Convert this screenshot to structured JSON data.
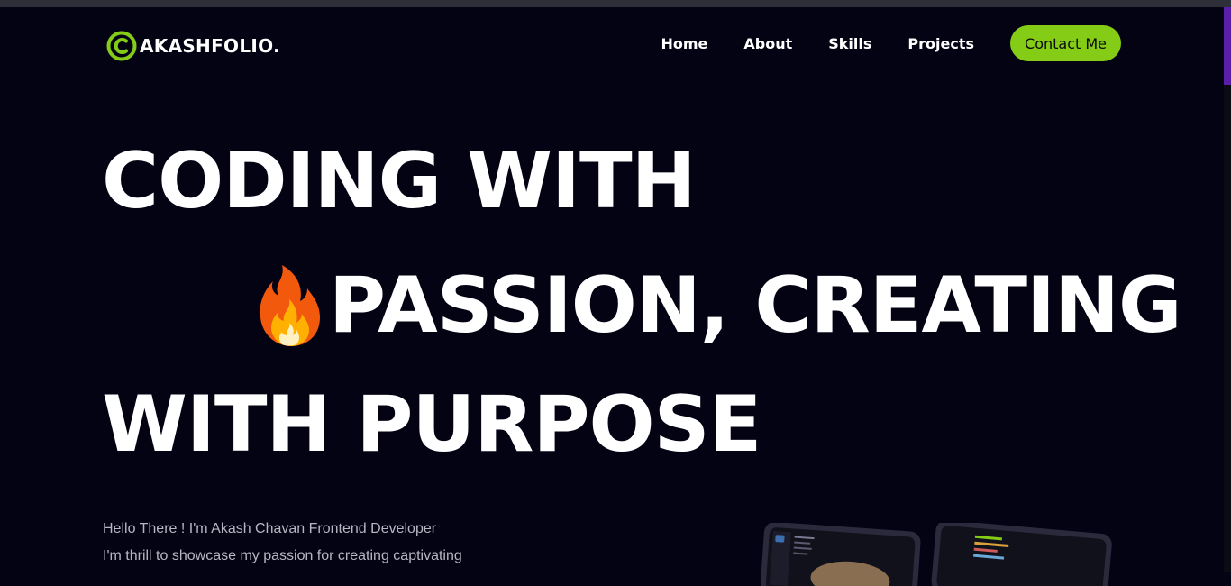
{
  "header": {
    "logo_text": "AKASHFOLIO.",
    "nav": [
      {
        "label": "Home"
      },
      {
        "label": "About"
      },
      {
        "label": "Skills"
      },
      {
        "label": "Projects"
      }
    ],
    "contact_label": "Contact Me"
  },
  "hero": {
    "line1": "CODING WITH",
    "line2": "PASSION, CREATING",
    "line3": "WITH PURPOSE",
    "emoji_icon": "fire-icon"
  },
  "intro": {
    "line1": "Hello There ! I'm Akash Chavan Frontend Developer",
    "line2": "I'm thrill to showcase my passion for creating captivating"
  },
  "colors": {
    "background": "#030314",
    "accent": "#84cc16",
    "scroll_thumb": "#5b1ea9"
  }
}
